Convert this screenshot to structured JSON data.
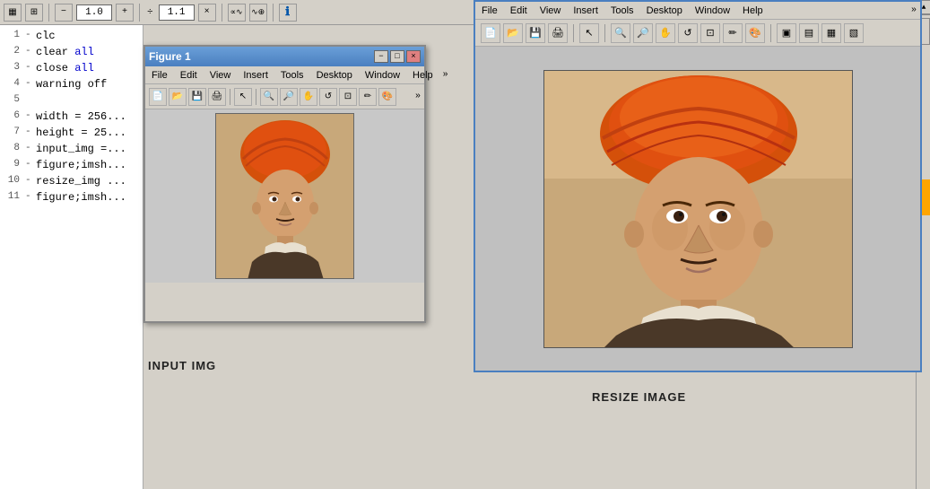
{
  "toolbar": {
    "minus_label": "−",
    "value1": "1.0",
    "plus_label": "+",
    "icon_label": "÷",
    "value2": "1.1",
    "close_label": "×",
    "icons": [
      "⊕",
      "⊗",
      "⚙"
    ],
    "info_icon": "ℹ"
  },
  "code": {
    "lines": [
      {
        "num": "1",
        "text": "clc"
      },
      {
        "num": "2",
        "text": "clear all",
        "highlight": "all"
      },
      {
        "num": "3",
        "text": "close all",
        "highlight": "all"
      },
      {
        "num": "4",
        "text": "warning off"
      },
      {
        "num": "5",
        "text": ""
      },
      {
        "num": "6",
        "text": "width = 256..."
      },
      {
        "num": "7",
        "text": "height = 25..."
      },
      {
        "num": "8",
        "text": "input_img =..."
      },
      {
        "num": "9",
        "text": "figure;imsh..."
      },
      {
        "num": "10",
        "text": "resize_img ..."
      },
      {
        "num": "11",
        "text": "figure;imsh..."
      }
    ]
  },
  "figure1": {
    "title": "Figure 1",
    "menus": [
      "File",
      "Edit",
      "View",
      "Insert",
      "Tools",
      "Desktop",
      "Window",
      "Help"
    ],
    "label": "INPUT IMG"
  },
  "figure2": {
    "menus": [
      "File",
      "Edit",
      "View",
      "Insert",
      "Tools",
      "Desktop",
      "Window",
      "Help"
    ],
    "label": "RESIZE IMAGE"
  },
  "icons": {
    "minimize": "−",
    "maximize": "□",
    "close": "×"
  }
}
